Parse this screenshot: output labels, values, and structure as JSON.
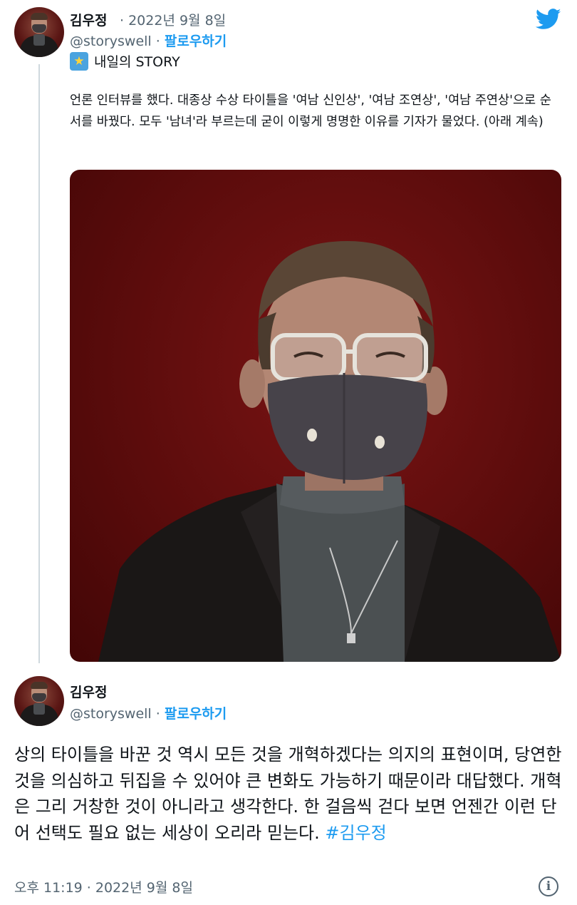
{
  "tweet1": {
    "author_name": "김우정",
    "separator": "·",
    "date": "2022년 9월 8일",
    "handle": "@storyswell",
    "handle_sep": "·",
    "follow_label": "팔로우하기",
    "story_label": "내일의 STORY",
    "story_icon": "shooting-star-icon",
    "text": "언론 인터뷰를 했다. 대종상 수상 타이틀을 '여남 신인상', '여남 조연상', '여남 주연상'으로 순서를 바꿨다. 모두 '남녀'라 부르는데 굳이 이렇게 명명한 이유를 기자가 물었다. (아래 계속)"
  },
  "tweet2": {
    "author_name": "김우정",
    "handle": "@storyswell",
    "handle_sep": "·",
    "follow_label": "팔로우하기",
    "text": "상의 타이틀을 바꾼 것 역시 모든 것을 개혁하겠다는 의지의 표현이며, 당연한 것을 의심하고 뒤집을 수 있어야 큰 변화도 가능하기 때문이라 대답했다. 개혁은 그리 거창한 것이 아니라고 생각한다. 한 걸음씩 걷다 보면 언젠간 이런 단어 선택도 필요 없는 세상이 오리라 믿는다. ",
    "hashtag": "#김우정",
    "timestamp": "오후 11:19 · 2022년 9월 8일",
    "info_icon": "i"
  },
  "colors": {
    "link": "#1d9bf0",
    "muted": "#536471",
    "photo_bg": "#5c0c0c"
  },
  "icons": [
    "twitter-bird-icon",
    "info-icon",
    "shooting-star-icon"
  ]
}
